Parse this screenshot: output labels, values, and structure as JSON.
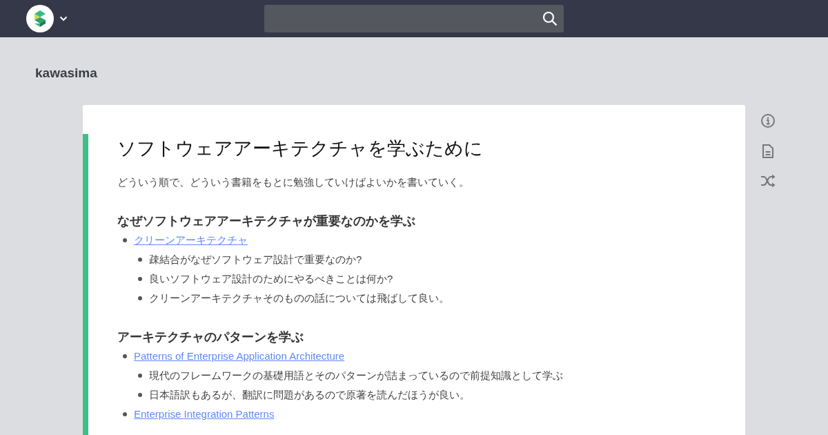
{
  "project": "kawasima",
  "page": {
    "title": "ソフトウェアアーキテクチャを学ぶために",
    "body": [
      {
        "kind": "text",
        "text": "どういう順で、どういう書籍をもとに勉強していけばよいかを書いていく。"
      },
      {
        "kind": "heading",
        "text": "なぜソフトウェアアーキテクチャが重要なのかを学ぶ"
      },
      {
        "kind": "bullets",
        "items": [
          {
            "text": "クリーンアーキテクチャ",
            "link": true,
            "children": [
              {
                "text": "疎結合がなぜソフトウェア設計で重要なのか?",
                "link": false
              },
              {
                "text": "良いソフトウェア設計のためにやるべきことは何か?",
                "link": false
              },
              {
                "text": "クリーンアーキテクチャそのものの話については飛ばして良い。",
                "link": false
              }
            ]
          }
        ]
      },
      {
        "kind": "heading",
        "text": "アーキテクチャのパターンを学ぶ"
      },
      {
        "kind": "bullets",
        "items": [
          {
            "text": "Patterns of Enterprise Application Architecture",
            "link": true,
            "children": [
              {
                "text": "現代のフレームワークの基礎用語とそのパターンが詰まっているので前提知識として学ぶ",
                "link": false
              },
              {
                "text": "日本語訳もあるが、翻訳に問題があるので原著を読んだほうが良い。",
                "link": false
              }
            ]
          },
          {
            "text": "Enterprise Integration Patterns",
            "link": true
          }
        ]
      }
    ]
  }
}
